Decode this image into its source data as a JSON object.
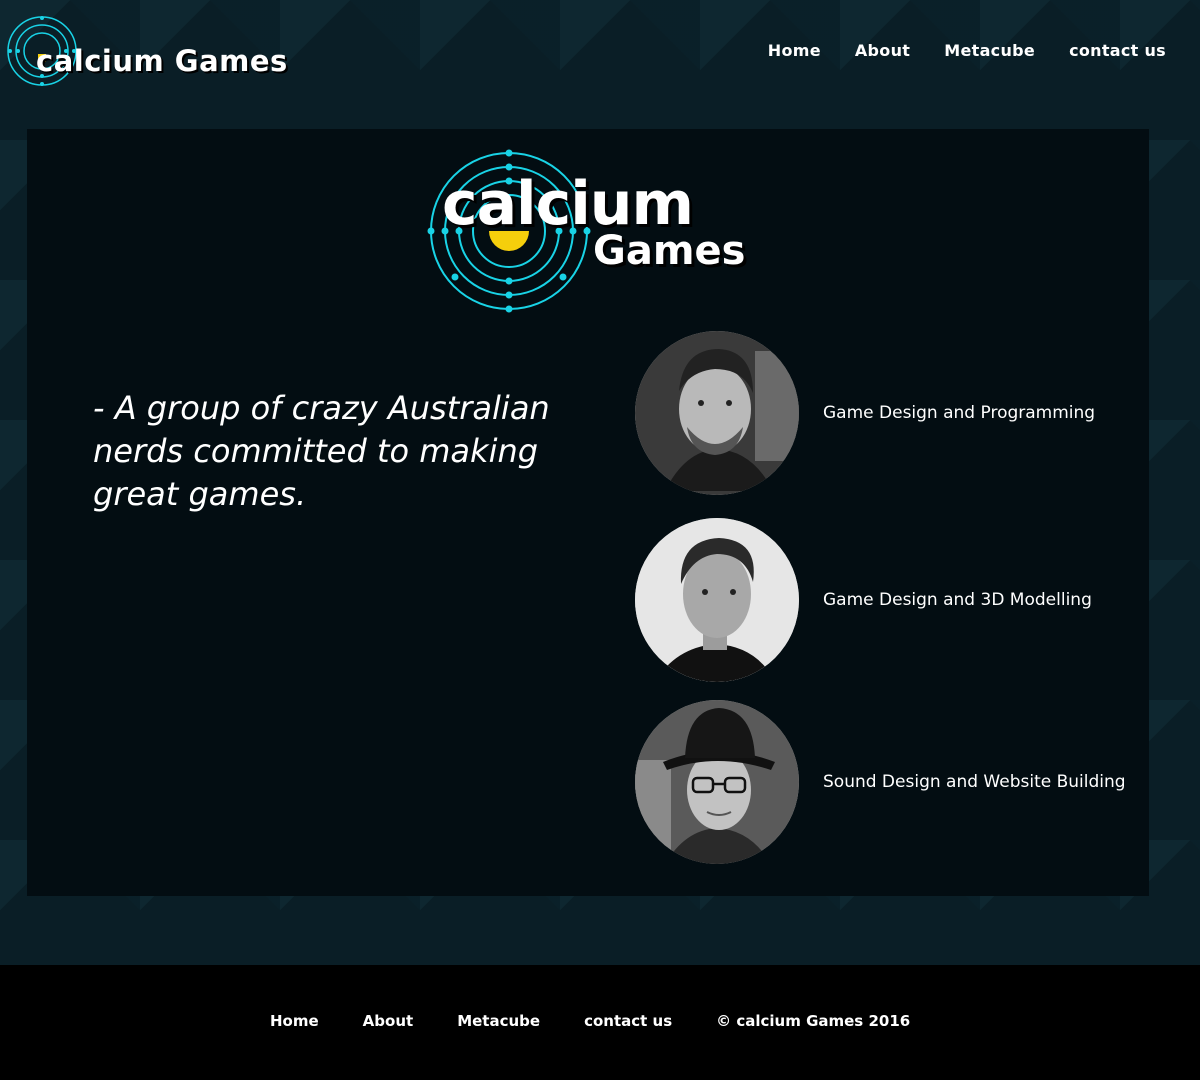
{
  "brand": {
    "name": "calcium Games",
    "big_line1": "calcium",
    "big_line2": "Games",
    "accent_cyan": "#19d3e6",
    "accent_yellow": "#f5cf0c"
  },
  "nav": {
    "items": [
      "Home",
      "About",
      "Metacube",
      "contact us"
    ]
  },
  "main": {
    "tagline": "- A group of crazy Australian nerds committed to making great games.",
    "members": [
      {
        "role": "Game Design and Programming",
        "avatar": "man-beard-photo"
      },
      {
        "role": "Game Design and 3D Modelling",
        "avatar": "young-man-photo"
      },
      {
        "role": "Sound Design and Website Building",
        "avatar": "woman-hat-glasses-photo"
      }
    ]
  },
  "footer": {
    "items": [
      "Home",
      "About",
      "Metacube",
      "contact us"
    ],
    "copyright": "© calcium Games 2016"
  }
}
